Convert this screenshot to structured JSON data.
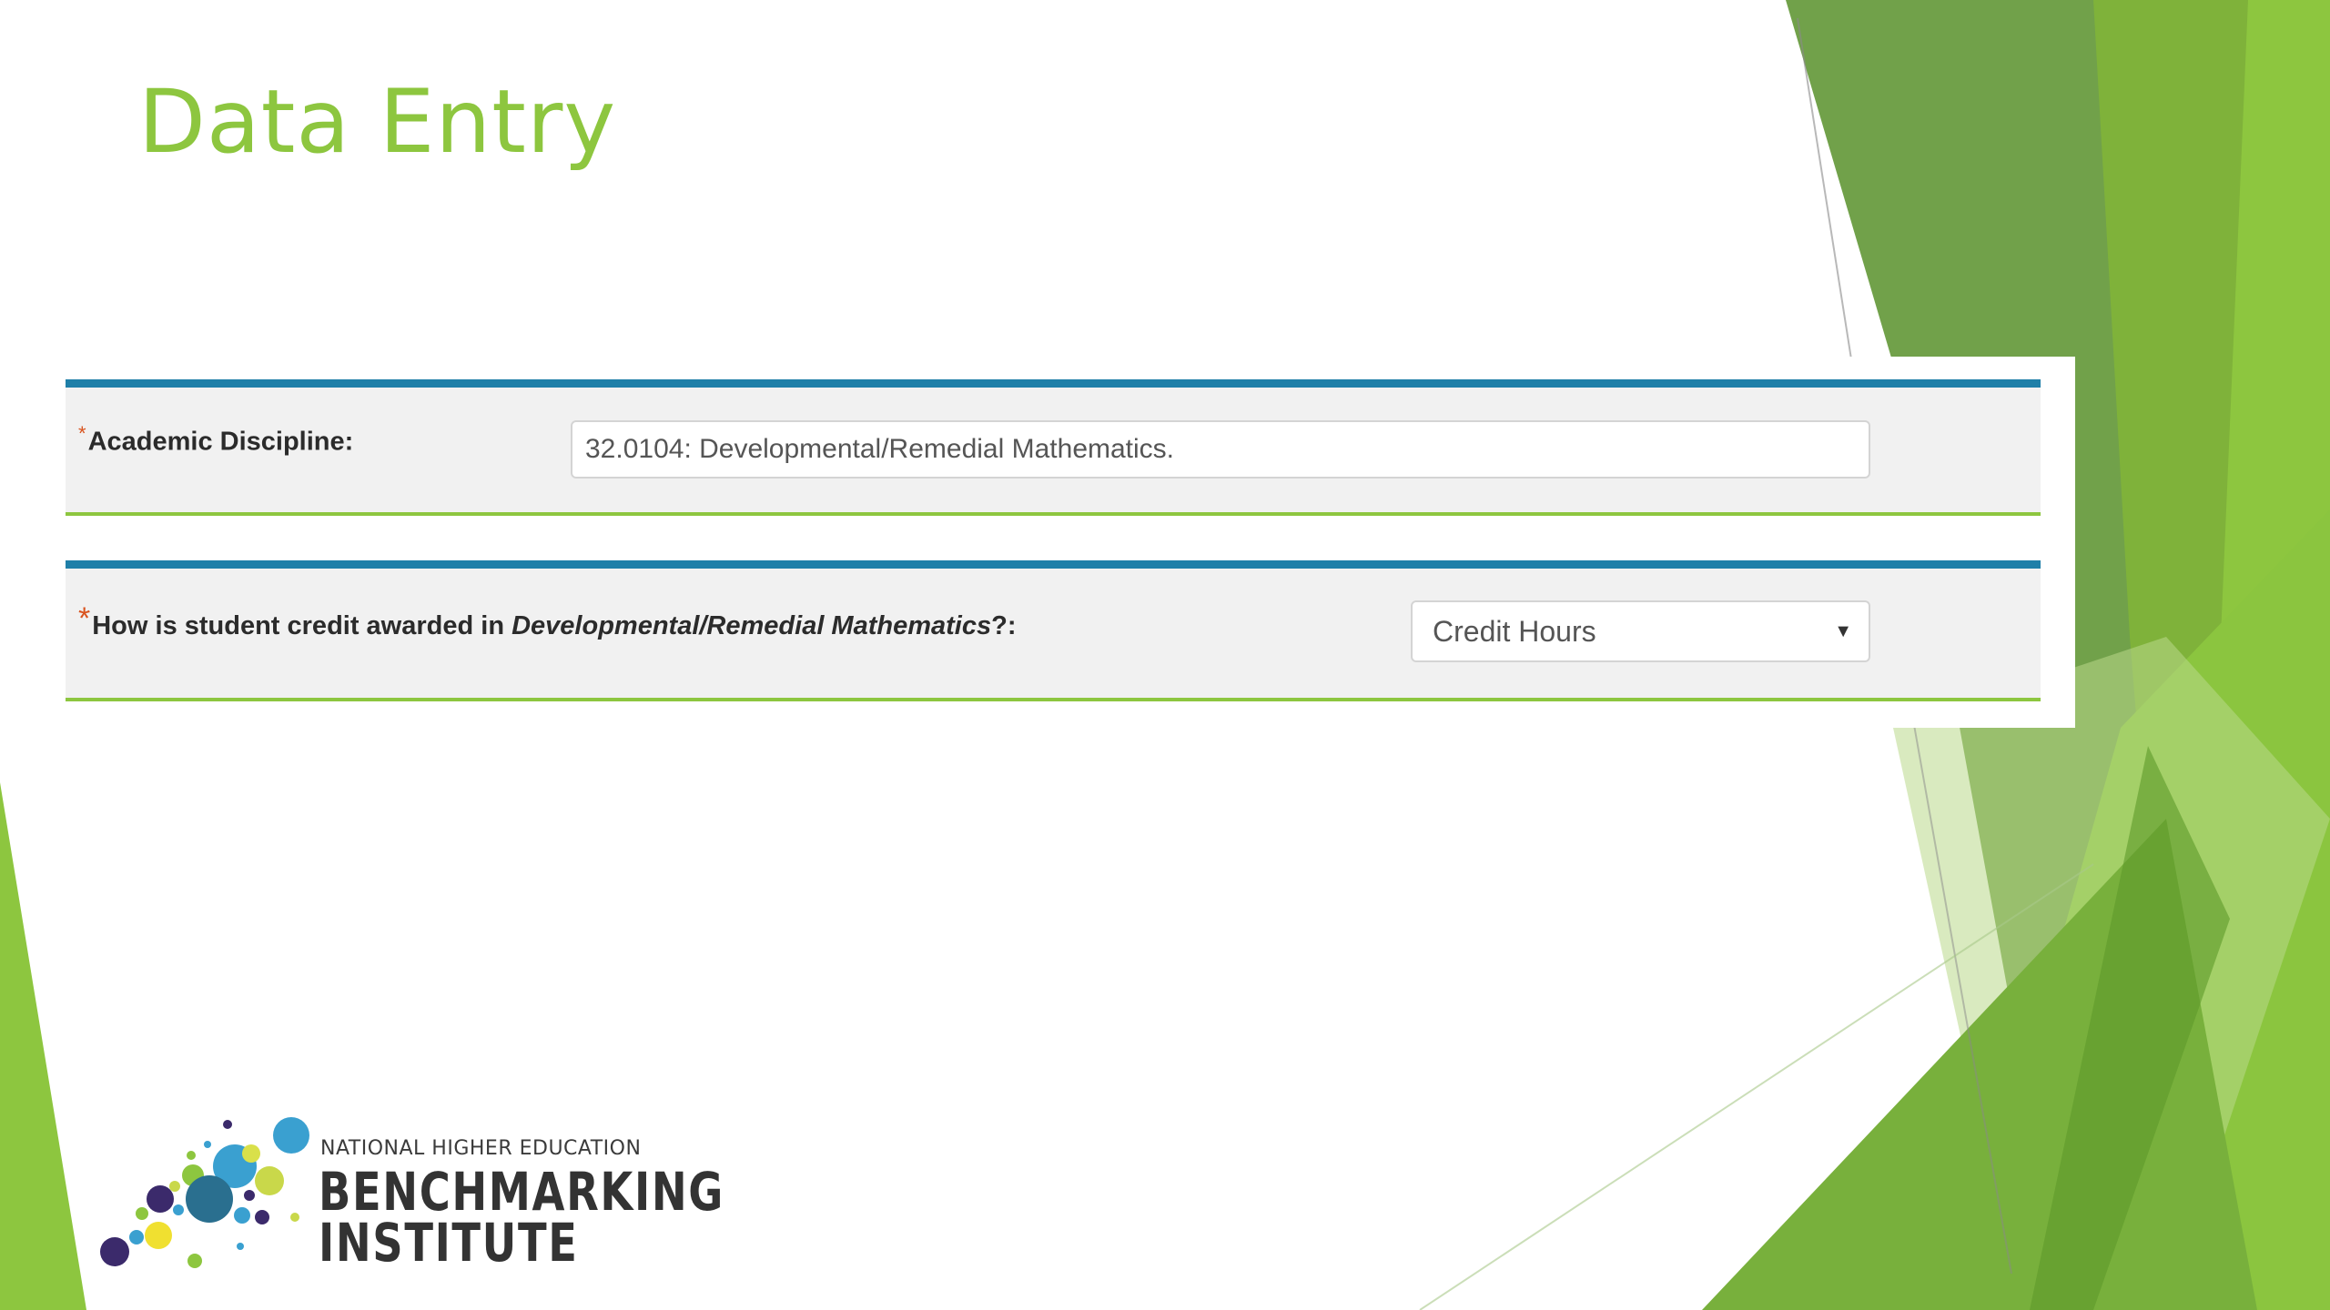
{
  "slide": {
    "title": "Data Entry"
  },
  "form": {
    "academic_discipline": {
      "required_marker": "*",
      "label": "Academic Discipline:",
      "value": "32.0104: Developmental/Remedial Mathematics."
    },
    "credit_question": {
      "required_marker": "*",
      "label_prefix": "How is student credit awarded in ",
      "label_emphasis": "Developmental/Remedial Mathematics",
      "label_suffix": "?:",
      "selected_option": "Credit Hours",
      "caret_icon": "▼"
    }
  },
  "logo": {
    "line1": "NATIONAL HIGHER EDUCATION",
    "line2": "BENCHMARKING",
    "line3": "INSTITUTE"
  },
  "colors": {
    "title_green": "#8dc63f",
    "row_top_border": "#1f7fa8",
    "row_bottom_border": "#8dc63f",
    "required_marker": "#d9531e",
    "row_background": "#f1f1f1"
  }
}
